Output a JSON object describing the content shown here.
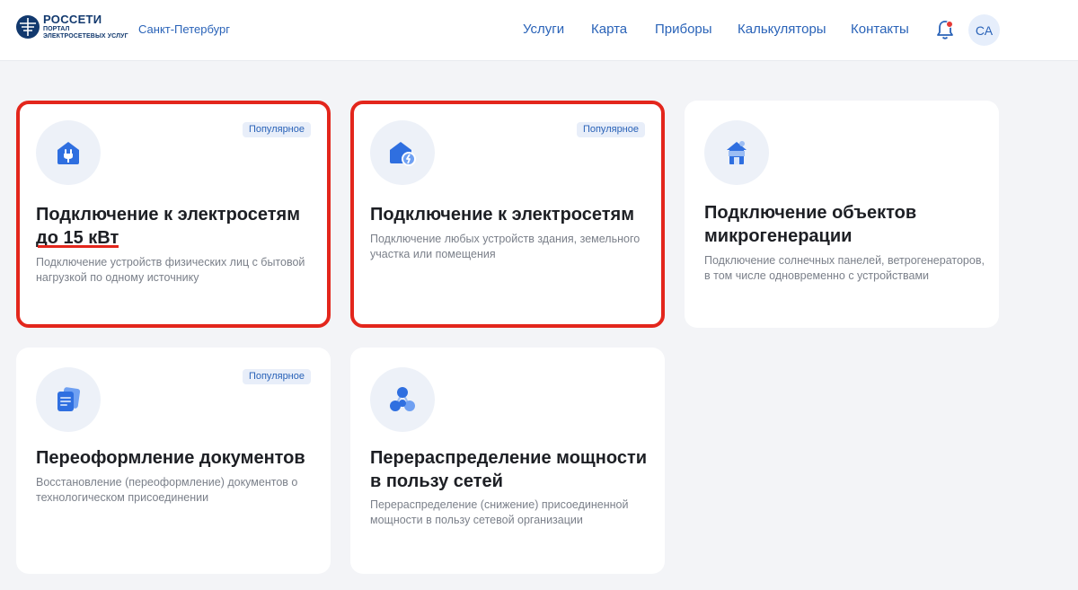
{
  "header": {
    "logo": {
      "title": "РОССЕТИ",
      "sub1": "ПОРТАЛ",
      "sub2": "ЭЛЕКТРОСЕТЕВЫХ УСЛУГ"
    },
    "city": "Санкт-Петербург",
    "nav": [
      "Услуги",
      "Карта",
      "Приборы",
      "Калькуляторы",
      "Контакты"
    ],
    "notifications": {
      "has_unread": true
    },
    "avatar_initials": "СА"
  },
  "colors": {
    "accent": "#2a63b8",
    "highlight": "#e3261c",
    "unread_dot": "#e53935"
  },
  "cards": [
    {
      "icon": "house-plug-icon",
      "badge": "Популярное",
      "title_line1": "Подключение к электросетям",
      "title_line2": "до 15 кВт",
      "description": "Подключение устройств физических лиц с бытовой нагрузкой по одному источнику",
      "highlighted": true
    },
    {
      "icon": "house-lightning-icon",
      "badge": "Популярное",
      "title_line1": "Подключение к электросетям",
      "title_line2": "",
      "description": "Подключение любых устройств здания, земельного участка или помещения",
      "highlighted": true
    },
    {
      "icon": "solar-house-icon",
      "badge": "",
      "title_line1": "Подключение объектов",
      "title_line2": "микрогенерации",
      "description": "Подключение солнечных панелей, ветрогенераторов, в том числе одновременно с устройствами",
      "highlighted": false
    },
    {
      "icon": "documents-icon",
      "badge": "Популярное",
      "title_line1": "Переоформление документов",
      "title_line2": "",
      "description": "Восстановление (переоформление) документов о технологическом присоединении",
      "highlighted": false
    },
    {
      "icon": "network-nodes-icon",
      "badge": "",
      "title_line1": "Перераспределение мощности",
      "title_line2": "в пользу сетей",
      "description": "Перераспределение (снижение) присоединенной мощности в пользу сетевой организации",
      "highlighted": false
    }
  ]
}
